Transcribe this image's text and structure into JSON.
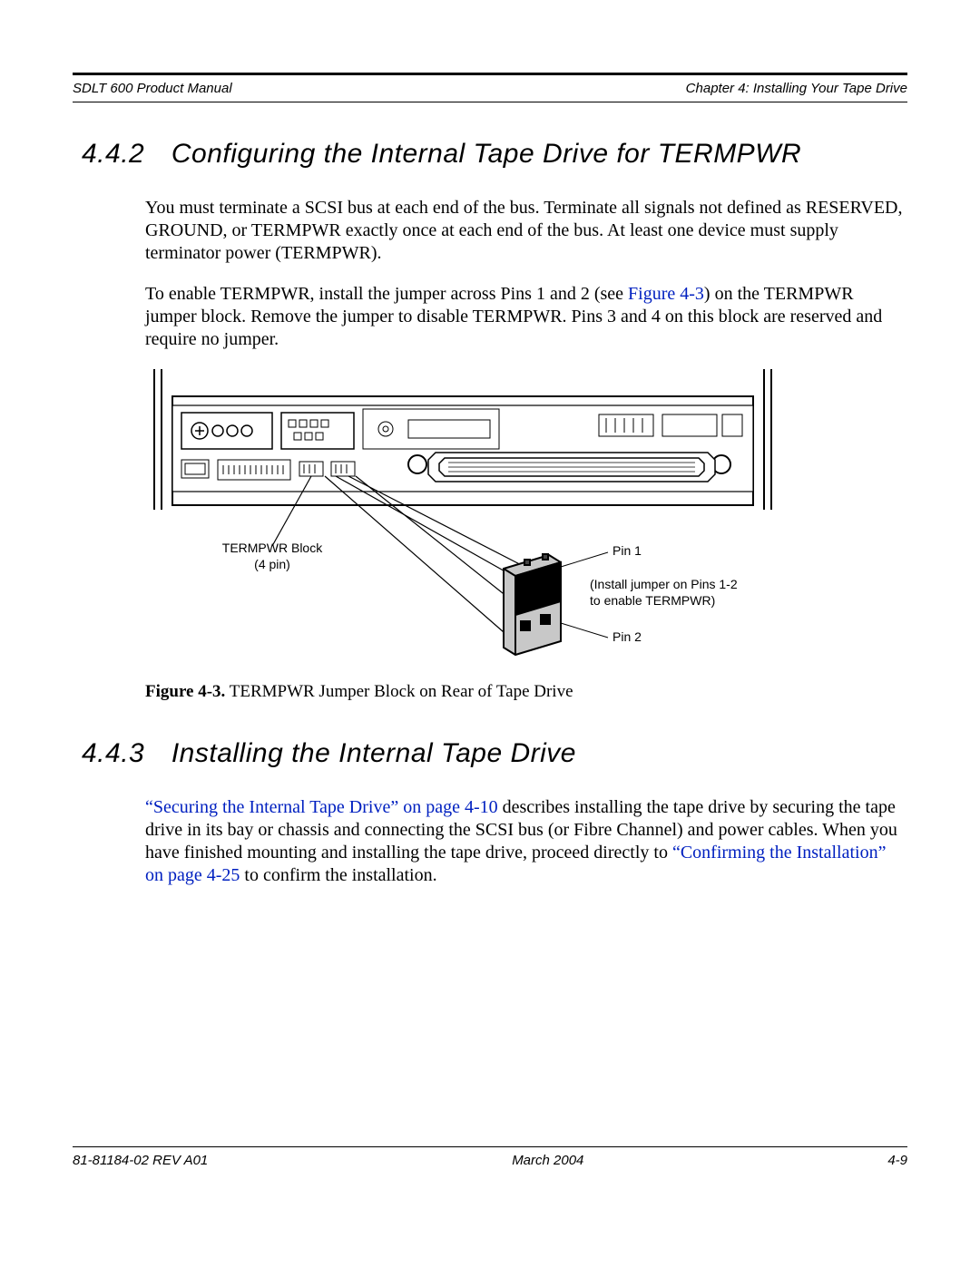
{
  "header": {
    "left": "SDLT 600 Product Manual",
    "right": "Chapter 4: Installing Your Tape Drive"
  },
  "section442": {
    "number": "4.4.2",
    "title": "Configuring the Internal Tape Drive for TERMPWR",
    "para1": "You must terminate a SCSI bus at each end of the bus. Terminate all signals not defined as RESERVED, GROUND, or TERMPWR exactly once at each end of the bus. At least one device must supply terminator power (TERMPWR).",
    "para2_a": "To enable TERMPWR, install the jumper across Pins 1 and 2 (see ",
    "para2_link": "Figure 4-3",
    "para2_b": ") on the TERMPWR jumper block. Remove the jumper to disable TERMPWR. Pins 3 and 4 on this block are reserved and require no jumper."
  },
  "figure": {
    "label_termpwr_block_l1": "TERMPWR Block",
    "label_termpwr_block_l2": "(4 pin)",
    "label_pin1": "Pin 1",
    "label_install_l1": "(Install jumper on Pins 1-2",
    "label_install_l2": "to enable TERMPWR)",
    "label_pin2": "Pin 2",
    "caption_bold": "Figure 4-3.",
    "caption_text": "TERMPWR Jumper Block on Rear of Tape Drive"
  },
  "section443": {
    "number": "4.4.3",
    "title": "Installing the Internal Tape Drive",
    "link1": "“Securing the Internal Tape Drive” on page 4-10",
    "para_a": " describes installing the tape drive by securing the tape drive in its bay or chassis and connecting the SCSI bus (or Fibre Channel) and power cables. When you have finished mounting and installing the tape drive, proceed directly to ",
    "link2": "“Confirming the Installation” on page 4-25",
    "para_b": " to confirm the installation."
  },
  "footer": {
    "left": "81-81184-02 REV A01",
    "center": "March 2004",
    "right": "4-9"
  }
}
